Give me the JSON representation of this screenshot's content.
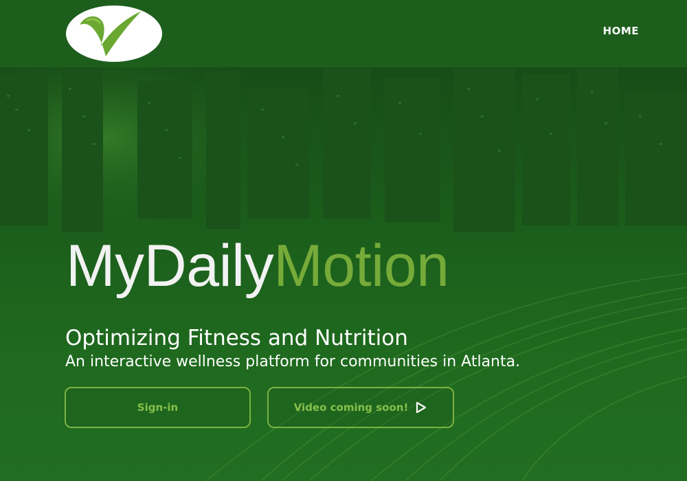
{
  "header": {
    "logo_icon": "checkmark-swoosh-logo-icon",
    "nav": {
      "home_label": "HOME"
    }
  },
  "hero": {
    "title_part1": "MyDaily",
    "title_part2": "Motion",
    "subtitle": "Optimizing Fitness and Nutrition",
    "tagline": "An interactive wellness platform for communities in Atlanta.",
    "buttons": {
      "signin_label": "Sign-in",
      "video_label": "Video coming soon!",
      "video_icon": "play-outline-icon"
    }
  },
  "colors": {
    "background": "#1c5a1c",
    "accent_green": "#76ab3a",
    "button_border": "#7cb342",
    "text_white": "#ffffff"
  }
}
